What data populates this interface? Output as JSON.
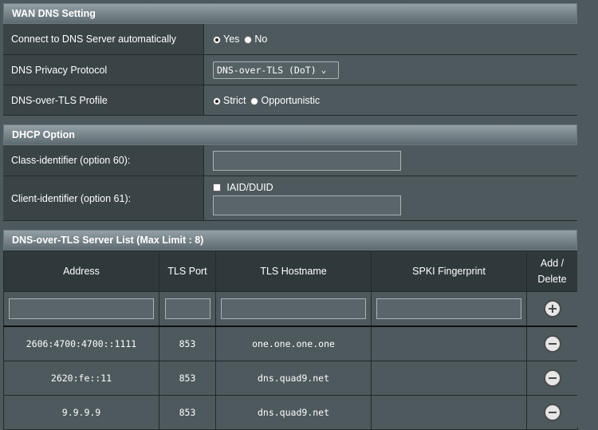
{
  "wan_dns": {
    "title": "WAN DNS Setting",
    "connect_auto": {
      "label": "Connect to DNS Server automatically",
      "options": [
        "Yes",
        "No"
      ],
      "selected": "Yes"
    },
    "privacy_protocol": {
      "label": "DNS Privacy Protocol",
      "value": "DNS-over-TLS (DoT)"
    },
    "dot_profile": {
      "label": "DNS-over-TLS Profile",
      "options": [
        "Strict",
        "Opportunistic"
      ],
      "selected": "Strict"
    }
  },
  "dhcp": {
    "title": "DHCP Option",
    "class_identifier": {
      "label": "Class-identifier (option 60):",
      "value": ""
    },
    "client_identifier": {
      "label": "Client-identifier (option 61):",
      "checkbox_label": "IAID/DUID",
      "value": ""
    }
  },
  "dot_list": {
    "title": "DNS-over-TLS Server List (Max Limit : 8)",
    "columns": [
      "Address",
      "TLS Port",
      "TLS Hostname",
      "SPKI Fingerprint",
      "Add / Delete"
    ],
    "servers": [
      {
        "address": "2606:4700:4700::1111",
        "port": "853",
        "hostname": "one.one.one.one",
        "spki": ""
      },
      {
        "address": "2620:fe::11",
        "port": "853",
        "hostname": "dns.quad9.net",
        "spki": ""
      },
      {
        "address": "9.9.9.9",
        "port": "853",
        "hostname": "dns.quad9.net",
        "spki": ""
      }
    ]
  },
  "icons": {
    "add": "plus-circle-icon",
    "delete": "minus-circle-icon",
    "dropdown": "chevron-down-icon"
  }
}
